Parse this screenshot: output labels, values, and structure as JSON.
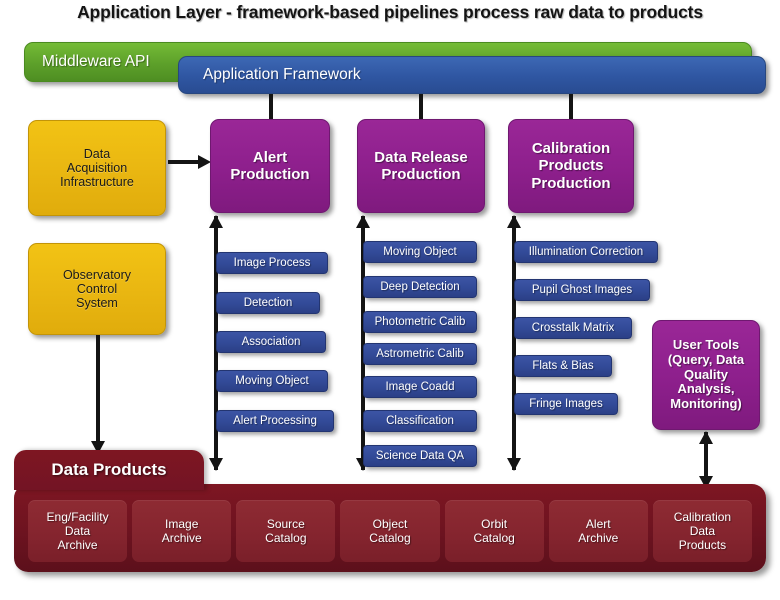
{
  "title": "Application Layer - framework-based pipelines process raw data to products",
  "bars": {
    "middleware": "Middleware API",
    "framework": "Application Framework"
  },
  "inputs": [
    {
      "label": "Data\nAcquisition\nInfrastructure",
      "name": "data-acquisition-infrastructure"
    },
    {
      "label": "Observatory\nControl\nSystem",
      "name": "observatory-control-system"
    }
  ],
  "productions": [
    {
      "label": "Alert\nProduction",
      "name": "alert-production"
    },
    {
      "label": "Data Release\nProduction",
      "name": "data-release-production"
    },
    {
      "label": "Calibration\nProducts\nProduction",
      "name": "calibration-products-production"
    }
  ],
  "pipelines": {
    "alert": [
      "Image Process",
      "Detection",
      "Association",
      "Moving Object",
      "Alert Processing"
    ],
    "data_release": [
      "Moving Object",
      "Deep Detection",
      "Photometric Calib",
      "Astrometric Calib",
      "Image Coadd",
      "Classification",
      "Science Data QA"
    ],
    "calibration": [
      "Illumination Correction",
      "Pupil Ghost Images",
      "Crosstalk Matrix",
      "Flats & Bias",
      "Fringe Images"
    ]
  },
  "user_tools": "User Tools\n(Query, Data\nQuality\nAnalysis,\nMonitoring)",
  "data_products": {
    "header": "Data Products",
    "tiles": [
      "Eng/Facility\nData\nArchive",
      "Image\nArchive",
      "Source\nCatalog",
      "Object\nCatalog",
      "Orbit\nCatalog",
      "Alert\nArchive",
      "Calibration\nData\nProducts"
    ]
  },
  "colors": {
    "middleware_green": "#5da02a",
    "framework_blue": "#2f56a2",
    "input_gold": "#e9b611",
    "production_purple": "#8d1f8c",
    "pipeline_chip_blue": "#324a97",
    "data_products_maroon": "#6d1320",
    "tile_maroon": "#84242e",
    "connector_black": "#141414"
  }
}
